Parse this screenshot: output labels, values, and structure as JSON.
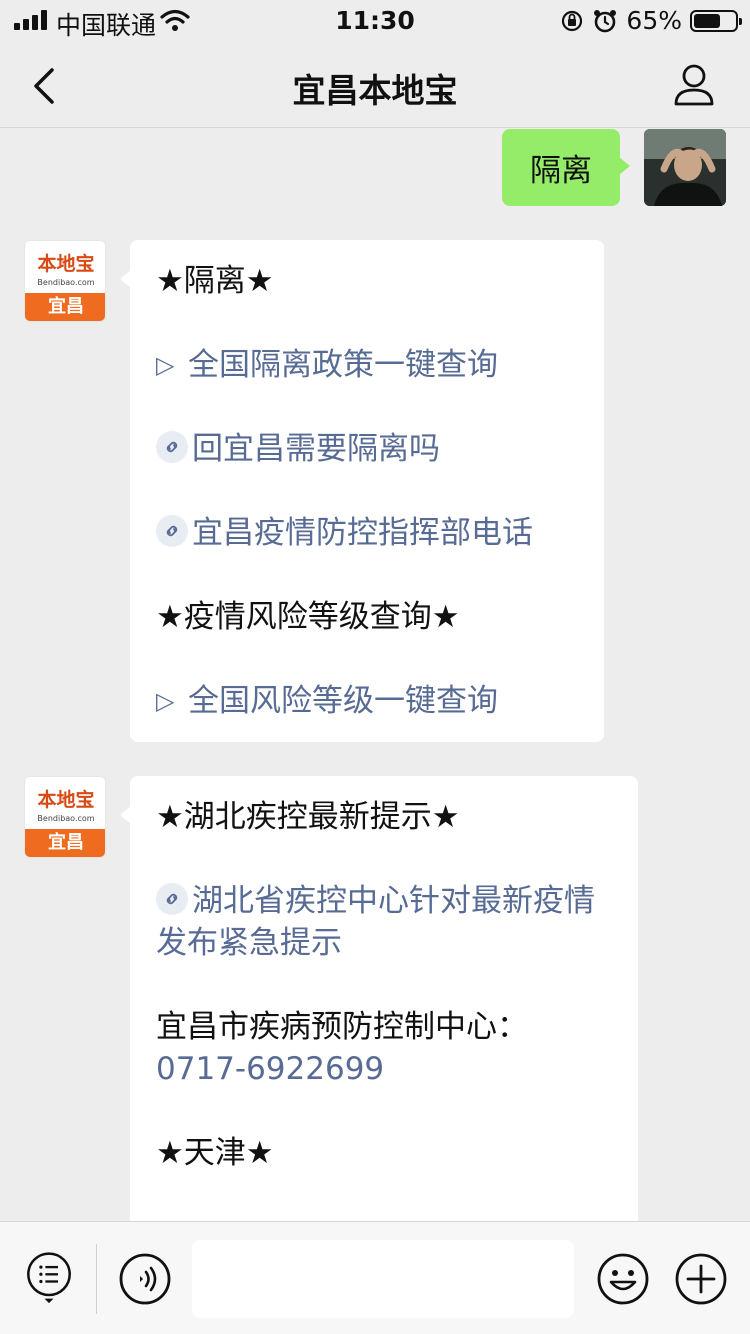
{
  "status_bar": {
    "carrier": "中国联通",
    "time": "11:30",
    "battery": "65%",
    "battery_level": 0.65
  },
  "nav": {
    "title": "宜昌本地宝",
    "back_icon": "chevron-left-icon",
    "profile_icon": "person-icon"
  },
  "messages": {
    "user": {
      "text": "隔离"
    },
    "bot1": {
      "brand_name": "本地宝",
      "brand_url": "Bendibao.com",
      "brand_city": "宜昌",
      "lines": [
        "★隔离★",
        "全国隔离政策一键查询",
        "回宜昌需要隔离吗",
        "宜昌疫情防控指挥部电话",
        "★疫情风险等级查询★",
        "全国风险等级一键查询"
      ],
      "triangle": "▷"
    },
    "bot2": {
      "brand_name": "本地宝",
      "brand_url": "Bendibao.com",
      "brand_city": "宜昌",
      "heading1": "★湖北疾控最新提示★",
      "link1": "湖北省疾控中心针对最新疫情发布紧急提示",
      "center_label": "宜昌市疾病预防控制中心：",
      "phone": "0717-6922699",
      "heading2": "★天津★"
    }
  },
  "toolbar": {
    "list_icon": "list-icon",
    "voice_icon": "voice-icon",
    "emoji_icon": "emoji-icon",
    "add_icon": "plus-icon"
  },
  "colors": {
    "background": "#ededed",
    "user_bubble": "#95ec69",
    "link": "#576b95",
    "brand_orange": "#ee6b1f"
  }
}
